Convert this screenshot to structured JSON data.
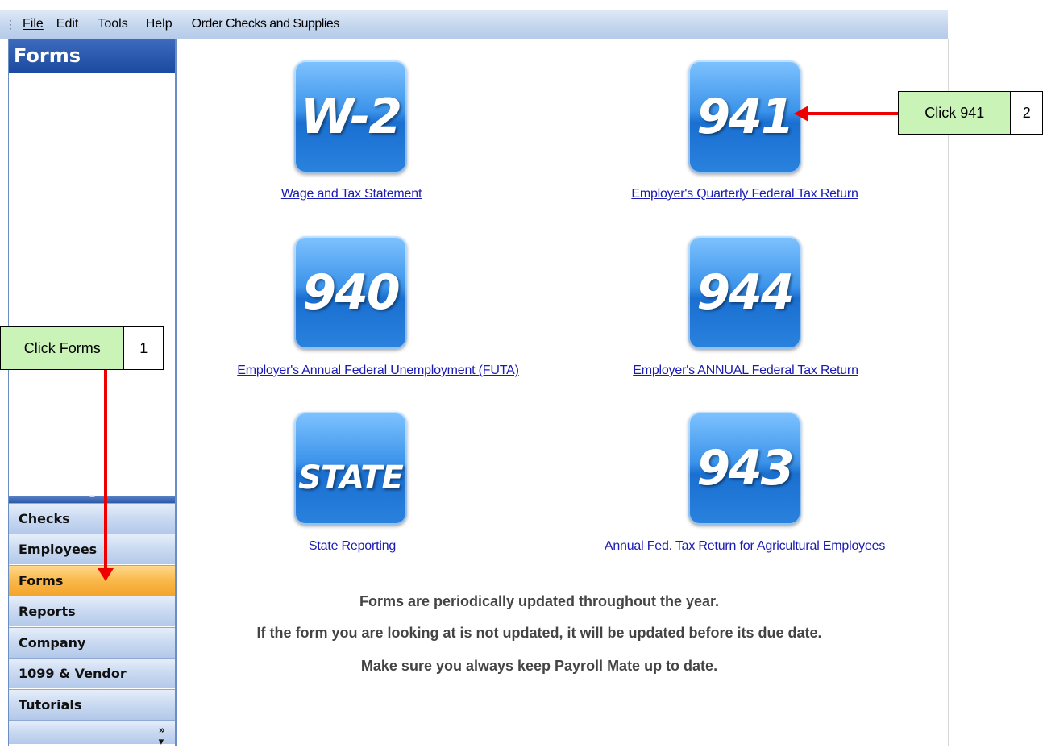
{
  "menu": {
    "items": [
      {
        "label": "File"
      },
      {
        "label": "Edit"
      },
      {
        "label": "Tools"
      },
      {
        "label": "Help"
      },
      {
        "label": "Order Checks and Supplies"
      }
    ]
  },
  "sidebar": {
    "title": "Forms",
    "nav": [
      {
        "label": "Checks"
      },
      {
        "label": "Employees"
      },
      {
        "label": "Forms",
        "active": true
      },
      {
        "label": "Reports"
      },
      {
        "label": "Company"
      },
      {
        "label": "1099 & Vendor"
      },
      {
        "label": "Tutorials"
      }
    ],
    "overflow_icon": "double-chevron-icon"
  },
  "forms": [
    {
      "tile": "W-2",
      "link": "Wage and Tax Statement"
    },
    {
      "tile": "941",
      "link": "Employer's Quarterly Federal Tax Return"
    },
    {
      "tile": "940",
      "link": "Employer's Annual Federal Unemployment (FUTA)"
    },
    {
      "tile": "944",
      "link": "Employer's ANNUAL Federal Tax Return"
    },
    {
      "tile": "STATE",
      "link": "State Reporting"
    },
    {
      "tile": "943",
      "link": "Annual Fed. Tax Return for Agricultural Employees"
    }
  ],
  "notes": [
    "Forms are periodically updated throughout the year.",
    "If the form you are looking at is not updated, it will be updated before its due date.",
    "Make sure you always keep Payroll Mate up to date."
  ],
  "callouts": [
    {
      "label": "Click Forms",
      "number": "1"
    },
    {
      "label": "Click 941",
      "number": "2"
    }
  ],
  "colors": {
    "tile_blue": "#2a82de",
    "link": "#1a1ab5",
    "active_nav": "#f9b84a",
    "callout_green": "#c9f3b7",
    "arrow_red": "#ee0000"
  }
}
